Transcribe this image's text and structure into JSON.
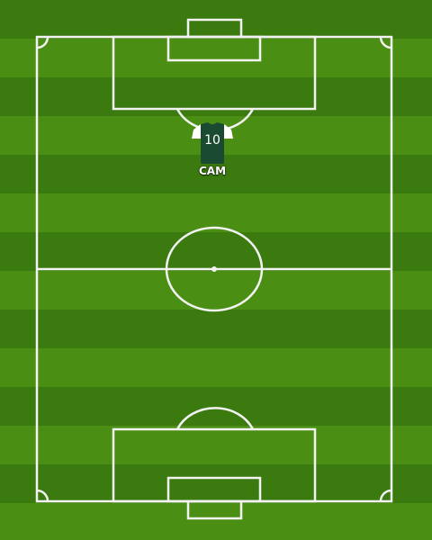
{
  "pitch": {
    "stripe_light": "#4a8f13",
    "stripe_dark": "#3b7a0e",
    "line_color": "#f2f2f2"
  },
  "player": {
    "number": "10",
    "position": "CAM",
    "shirt_color": "#1b4a32",
    "sleeve_color": "#ffffff"
  }
}
